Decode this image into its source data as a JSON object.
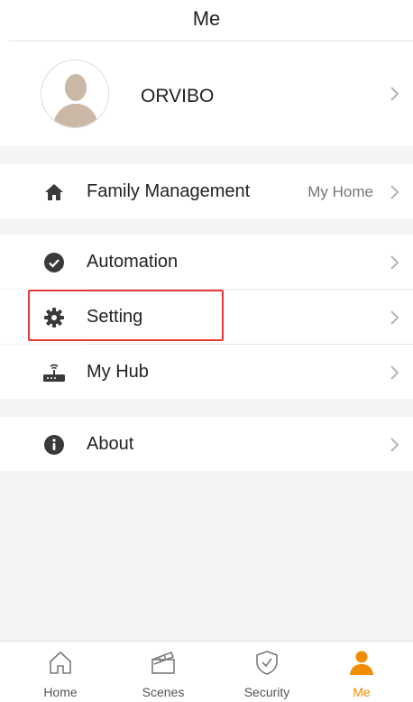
{
  "header": {
    "title": "Me"
  },
  "profile": {
    "name": "ORVIBO"
  },
  "menu": {
    "family_management": {
      "label": "Family Management",
      "value": "My Home"
    },
    "automation": {
      "label": "Automation"
    },
    "setting": {
      "label": "Setting"
    },
    "my_hub": {
      "label": "My Hub"
    },
    "about": {
      "label": "About"
    }
  },
  "tabs": [
    {
      "label": "Home",
      "icon": "home-icon"
    },
    {
      "label": "Scenes",
      "icon": "clapperboard-icon"
    },
    {
      "label": "Security",
      "icon": "shield-check-icon"
    },
    {
      "label": "Me",
      "icon": "person-icon",
      "active": true
    }
  ],
  "colors": {
    "accent": "#f28c00",
    "highlight": "#e53935",
    "icon_dark": "#3a3a3a",
    "background": "#f4f4f4"
  }
}
